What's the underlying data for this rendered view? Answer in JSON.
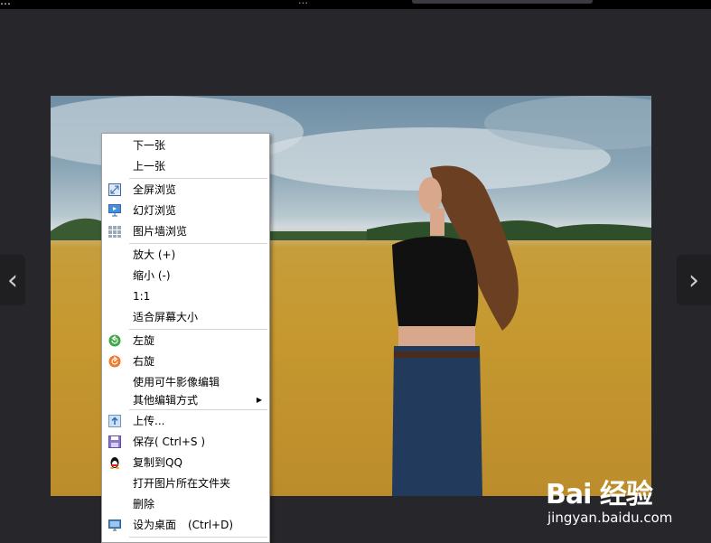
{
  "window": {
    "title": "…",
    "top_text": "…"
  },
  "photo": {
    "description_icon": "photo-wheat-field"
  },
  "nav": {
    "prev_icon": "‹",
    "next_icon": "›"
  },
  "menu": {
    "next": "下一张",
    "prev": "上一张",
    "fullscreen": "全屏浏览",
    "slideshow": "幻灯浏览",
    "wall": "图片墙浏览",
    "zoom_in": "放大 (+)",
    "zoom_out": "缩小 (-)",
    "actual": "1:1",
    "fit": "适合屏幕大小",
    "rotate_left": "左旋",
    "rotate_right": "右旋",
    "edit_keniu": "使用可牛影像编辑",
    "edit_other": "其他编辑方式",
    "upload": "上传...",
    "save": "保存( Ctrl+S )",
    "copy_qq": "复制到QQ",
    "open_folder": "打开图片所在文件夹",
    "delete": "删除",
    "wallpaper": "设为桌面",
    "wallpaper_shortcut": "(Ctrl+D)"
  },
  "watermark": {
    "logo": "Bai 经验",
    "url": "jingyan.baidu.com"
  },
  "colors": {
    "background": "#27272b",
    "menu_bg": "#ffffff",
    "separator": "#d4d4d4"
  }
}
